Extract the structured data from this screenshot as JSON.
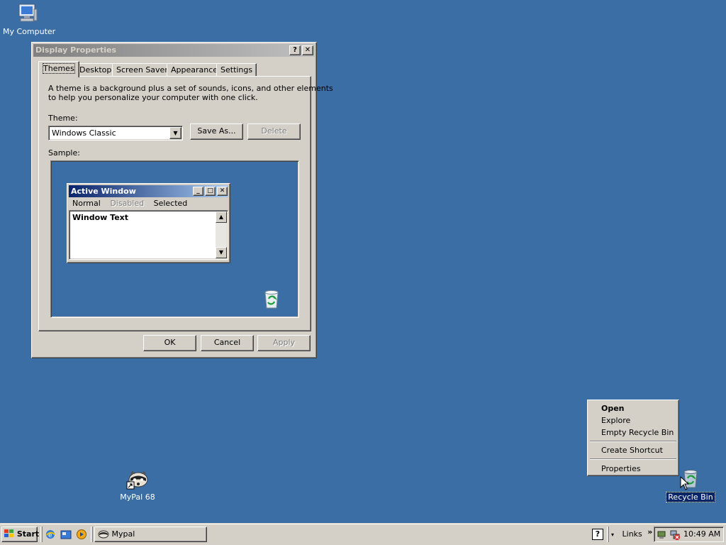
{
  "desktop": {
    "icons": [
      {
        "label": "My Computer"
      },
      {
        "label": "MyPal 68"
      },
      {
        "label": "Recycle Bin"
      }
    ]
  },
  "dialog": {
    "title": "Display Properties",
    "help_btn": "?",
    "close_btn": "✕",
    "tabs": [
      "Themes",
      "Desktop",
      "Screen Saver",
      "Appearance",
      "Settings"
    ],
    "active_tab": "Themes",
    "description_line1": "A theme is a background plus a set of sounds, icons, and other elements",
    "description_line2": "to help you personalize your computer with one click.",
    "theme_label": "Theme:",
    "theme_value": "Windows Classic",
    "save_as": "Save As...",
    "delete": "Delete",
    "sample_label": "Sample:",
    "sample": {
      "window_title": "Active Window",
      "menu_normal": "Normal",
      "menu_disabled": "Disabled",
      "menu_selected": "Selected",
      "window_text": "Window Text"
    },
    "ok": "OK",
    "cancel": "Cancel",
    "apply": "Apply"
  },
  "context_menu": {
    "items": [
      "Open",
      "Explore",
      "Empty Recycle Bin",
      "Create Shortcut",
      "Properties"
    ],
    "default_item": "Open"
  },
  "taskbar": {
    "start": "Start",
    "task": "Mypal",
    "links": "Links",
    "chevron": "»",
    "clock": "10:49 AM"
  },
  "colors": {
    "desktop": "#3a6ea5",
    "face": "#d4d0c8",
    "active_title": "#0a246a",
    "inactive_title": "#808080"
  }
}
